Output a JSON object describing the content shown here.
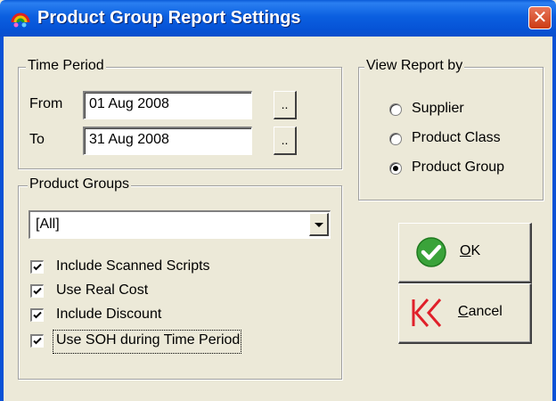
{
  "window": {
    "title": "Product Group Report Settings"
  },
  "time_period": {
    "legend": "Time Period",
    "from_label": "From",
    "from_value": "01 Aug 2008",
    "to_label": "To",
    "to_value": "31 Aug 2008",
    "browse_label": ".."
  },
  "view_report_by": {
    "legend": "View Report by",
    "options": [
      {
        "label": "Supplier",
        "selected": false
      },
      {
        "label": "Product Class",
        "selected": false
      },
      {
        "label": "Product Group",
        "selected": true
      }
    ]
  },
  "product_groups": {
    "legend": "Product Groups",
    "selected": "[All]",
    "options": [
      {
        "label": "Include Scanned Scripts",
        "checked": true
      },
      {
        "label": "Use Real Cost",
        "checked": true
      },
      {
        "label": "Include Discount",
        "checked": true
      },
      {
        "label": "Use SOH during Time Period",
        "checked": true
      }
    ]
  },
  "buttons": {
    "ok_first": "O",
    "ok_rest": "K",
    "cancel_first": "C",
    "cancel_rest": "ancel"
  },
  "icons": {
    "ok": "check-circle-icon",
    "cancel": "double-chevron-left-icon",
    "app": "rainbow-app-icon"
  }
}
